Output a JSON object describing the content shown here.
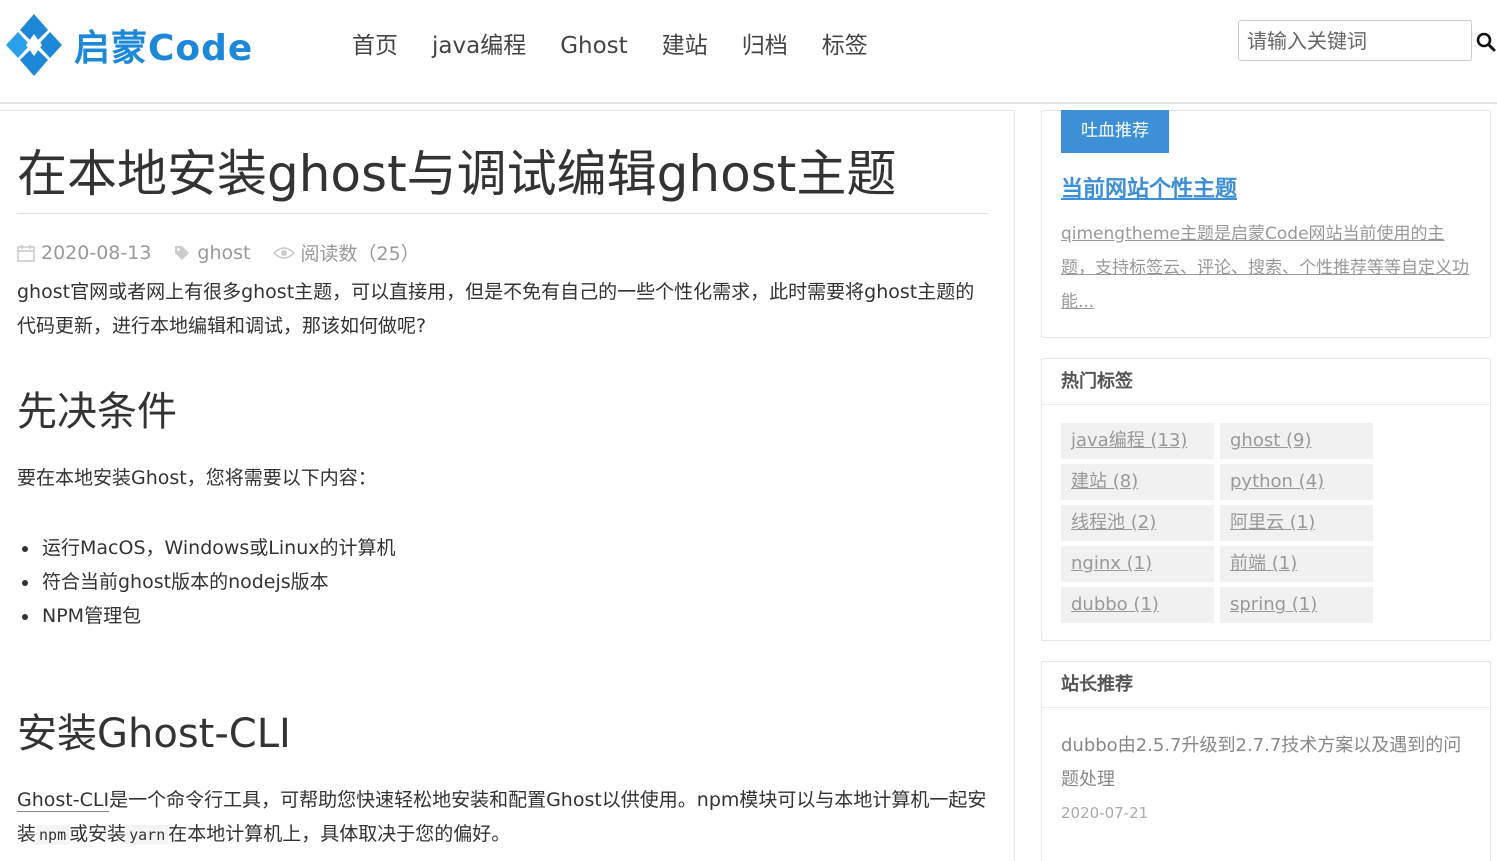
{
  "header": {
    "logo_text": "启蒙Code",
    "nav": [
      "首页",
      "java编程",
      "Ghost",
      "建站",
      "归档",
      "标签"
    ],
    "search_placeholder": "请输入关键词"
  },
  "post": {
    "title": "在本地安装ghost与调试编辑ghost主题",
    "date": "2020-08-13",
    "tag": "ghost",
    "views": "阅读数（25）",
    "intro": "ghost官网或者网上有很多ghost主题，可以直接用，但是不免有自己的一些个性化需求，此时需要将ghost主题的代码更新，进行本地编辑和调试，那该如何做呢?",
    "h2_prereq": "先决条件",
    "prereq_text": "要在本地安装Ghost，您将需要以下内容：",
    "bullets": [
      "运行MacOS，Windows或Linux的计算机",
      "符合当前ghost版本的nodejs版本",
      "NPM管理包"
    ],
    "h2_install": "安装Ghost-CLI",
    "install_link": "Ghost-CLI",
    "install_text_1": "是一个命令行工具，可帮助您快速轻松地安装和配置Ghost以供使用。npm模块可以与本地计算机一起安装",
    "code_npm": "npm",
    "install_text_2": "或安装",
    "code_yarn": "yarn",
    "install_text_3": "在本地计算机上，具体取决于您的偏好。"
  },
  "sidebar": {
    "recommend": {
      "badge": "吐血推荐",
      "title": "当前网站个性主题",
      "desc": "qimengtheme主题是启蒙Code网站当前使用的主题，支持标签云、评论、搜索、个性推荐等等自定义功能..."
    },
    "hot_tags": {
      "heading": "热门标签",
      "tags": [
        "java编程 (13)",
        "ghost (9)",
        "建站 (8)",
        "python (4)",
        "线程池 (2)",
        "阿里云 (1)",
        "nginx (1)",
        "前端 (1)",
        "dubbo (1)",
        "spring (1)"
      ]
    },
    "picks": {
      "heading": "站长推荐",
      "title": "dubbo由2.5.7升级到2.7.7技术方案以及遇到的问题处理",
      "date": "2020-07-21"
    }
  },
  "colors": {
    "accent": "#3d8fd6",
    "logo_blue": "#1e88d8"
  }
}
